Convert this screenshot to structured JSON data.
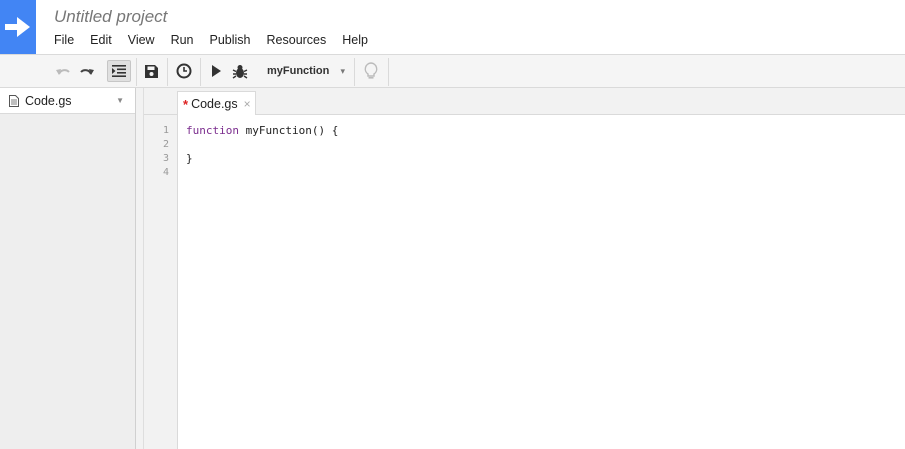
{
  "project": {
    "title": "Untitled project"
  },
  "menu": [
    "File",
    "Edit",
    "View",
    "Run",
    "Publish",
    "Resources",
    "Help"
  ],
  "toolbar": {
    "function_select": "myFunction",
    "icons": [
      "undo-icon",
      "redo-icon",
      "indent-icon",
      "save-icon",
      "triggers-clock-icon",
      "run-icon",
      "debug-bug-icon",
      "lightbulb-icon"
    ]
  },
  "sidebar": {
    "file": "Code.gs"
  },
  "tabs": [
    {
      "label": "Code.gs",
      "modified_marker": "*",
      "close": "×"
    }
  ],
  "editor": {
    "line_numbers": [
      "1",
      "2",
      "3",
      "4"
    ],
    "lines": [
      {
        "keyword": "function",
        "rest": " myFunction() {"
      },
      {
        "keyword": "",
        "rest": ""
      },
      {
        "keyword": "",
        "rest": "}"
      },
      {
        "keyword": "",
        "rest": ""
      }
    ]
  }
}
